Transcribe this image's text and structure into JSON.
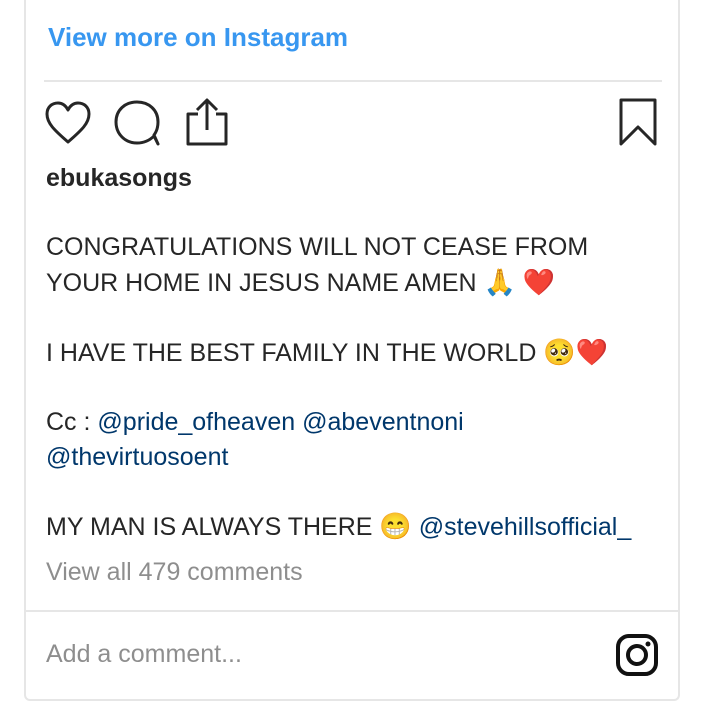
{
  "header": {
    "view_more_label": "View more on Instagram"
  },
  "actions": {
    "like_icon": "heart-icon",
    "comment_icon": "comment-icon",
    "share_icon": "share-icon",
    "save_icon": "bookmark-icon"
  },
  "post": {
    "username": "ebukasongs",
    "caption": {
      "line1": "CONGRATULATIONS WILL NOT CEASE FROM",
      "line2": "YOUR HOME IN JESUS NAME AMEN",
      "line2_emoji1": "🙏",
      "line2_emoji2": "❤️",
      "line3": "I HAVE THE BEST FAMILY IN THE WORLD",
      "line3_emoji1": "🥺",
      "line3_emoji2": "❤️",
      "cc_prefix": "Cc :",
      "mention1": "@pride_ofheaven",
      "mention2": "@abeventnoni",
      "mention3": "@thevirtuosoent",
      "line6": "MY MAN IS ALWAYS THERE",
      "line6_emoji": "😁",
      "mention4": "@stevehillsofficial_"
    },
    "view_all_comments": "View all 479 comments"
  },
  "comment_box": {
    "placeholder": "Add a comment...",
    "icon": "instagram-icon"
  },
  "colors": {
    "link_blue": "#3897f0",
    "mention_blue": "#00376b",
    "muted": "#8e8e8e",
    "border": "#e6e6e6",
    "heart_red": "#e0245e"
  }
}
